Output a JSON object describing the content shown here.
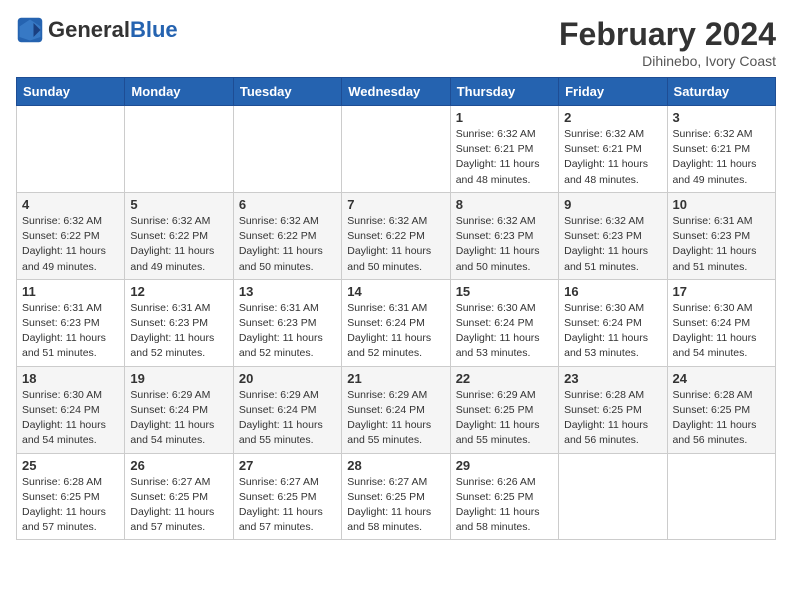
{
  "logo": {
    "general": "General",
    "blue": "Blue"
  },
  "header": {
    "month_year": "February 2024",
    "location": "Dihinebo, Ivory Coast"
  },
  "days_of_week": [
    "Sunday",
    "Monday",
    "Tuesday",
    "Wednesday",
    "Thursday",
    "Friday",
    "Saturday"
  ],
  "weeks": [
    [
      {
        "day": "",
        "info": ""
      },
      {
        "day": "",
        "info": ""
      },
      {
        "day": "",
        "info": ""
      },
      {
        "day": "",
        "info": ""
      },
      {
        "day": "1",
        "info": "Sunrise: 6:32 AM\nSunset: 6:21 PM\nDaylight: 11 hours\nand 48 minutes."
      },
      {
        "day": "2",
        "info": "Sunrise: 6:32 AM\nSunset: 6:21 PM\nDaylight: 11 hours\nand 48 minutes."
      },
      {
        "day": "3",
        "info": "Sunrise: 6:32 AM\nSunset: 6:21 PM\nDaylight: 11 hours\nand 49 minutes."
      }
    ],
    [
      {
        "day": "4",
        "info": "Sunrise: 6:32 AM\nSunset: 6:22 PM\nDaylight: 11 hours\nand 49 minutes."
      },
      {
        "day": "5",
        "info": "Sunrise: 6:32 AM\nSunset: 6:22 PM\nDaylight: 11 hours\nand 49 minutes."
      },
      {
        "day": "6",
        "info": "Sunrise: 6:32 AM\nSunset: 6:22 PM\nDaylight: 11 hours\nand 50 minutes."
      },
      {
        "day": "7",
        "info": "Sunrise: 6:32 AM\nSunset: 6:22 PM\nDaylight: 11 hours\nand 50 minutes."
      },
      {
        "day": "8",
        "info": "Sunrise: 6:32 AM\nSunset: 6:23 PM\nDaylight: 11 hours\nand 50 minutes."
      },
      {
        "day": "9",
        "info": "Sunrise: 6:32 AM\nSunset: 6:23 PM\nDaylight: 11 hours\nand 51 minutes."
      },
      {
        "day": "10",
        "info": "Sunrise: 6:31 AM\nSunset: 6:23 PM\nDaylight: 11 hours\nand 51 minutes."
      }
    ],
    [
      {
        "day": "11",
        "info": "Sunrise: 6:31 AM\nSunset: 6:23 PM\nDaylight: 11 hours\nand 51 minutes."
      },
      {
        "day": "12",
        "info": "Sunrise: 6:31 AM\nSunset: 6:23 PM\nDaylight: 11 hours\nand 52 minutes."
      },
      {
        "day": "13",
        "info": "Sunrise: 6:31 AM\nSunset: 6:23 PM\nDaylight: 11 hours\nand 52 minutes."
      },
      {
        "day": "14",
        "info": "Sunrise: 6:31 AM\nSunset: 6:24 PM\nDaylight: 11 hours\nand 52 minutes."
      },
      {
        "day": "15",
        "info": "Sunrise: 6:30 AM\nSunset: 6:24 PM\nDaylight: 11 hours\nand 53 minutes."
      },
      {
        "day": "16",
        "info": "Sunrise: 6:30 AM\nSunset: 6:24 PM\nDaylight: 11 hours\nand 53 minutes."
      },
      {
        "day": "17",
        "info": "Sunrise: 6:30 AM\nSunset: 6:24 PM\nDaylight: 11 hours\nand 54 minutes."
      }
    ],
    [
      {
        "day": "18",
        "info": "Sunrise: 6:30 AM\nSunset: 6:24 PM\nDaylight: 11 hours\nand 54 minutes."
      },
      {
        "day": "19",
        "info": "Sunrise: 6:29 AM\nSunset: 6:24 PM\nDaylight: 11 hours\nand 54 minutes."
      },
      {
        "day": "20",
        "info": "Sunrise: 6:29 AM\nSunset: 6:24 PM\nDaylight: 11 hours\nand 55 minutes."
      },
      {
        "day": "21",
        "info": "Sunrise: 6:29 AM\nSunset: 6:24 PM\nDaylight: 11 hours\nand 55 minutes."
      },
      {
        "day": "22",
        "info": "Sunrise: 6:29 AM\nSunset: 6:25 PM\nDaylight: 11 hours\nand 55 minutes."
      },
      {
        "day": "23",
        "info": "Sunrise: 6:28 AM\nSunset: 6:25 PM\nDaylight: 11 hours\nand 56 minutes."
      },
      {
        "day": "24",
        "info": "Sunrise: 6:28 AM\nSunset: 6:25 PM\nDaylight: 11 hours\nand 56 minutes."
      }
    ],
    [
      {
        "day": "25",
        "info": "Sunrise: 6:28 AM\nSunset: 6:25 PM\nDaylight: 11 hours\nand 57 minutes."
      },
      {
        "day": "26",
        "info": "Sunrise: 6:27 AM\nSunset: 6:25 PM\nDaylight: 11 hours\nand 57 minutes."
      },
      {
        "day": "27",
        "info": "Sunrise: 6:27 AM\nSunset: 6:25 PM\nDaylight: 11 hours\nand 57 minutes."
      },
      {
        "day": "28",
        "info": "Sunrise: 6:27 AM\nSunset: 6:25 PM\nDaylight: 11 hours\nand 58 minutes."
      },
      {
        "day": "29",
        "info": "Sunrise: 6:26 AM\nSunset: 6:25 PM\nDaylight: 11 hours\nand 58 minutes."
      },
      {
        "day": "",
        "info": ""
      },
      {
        "day": "",
        "info": ""
      }
    ]
  ]
}
